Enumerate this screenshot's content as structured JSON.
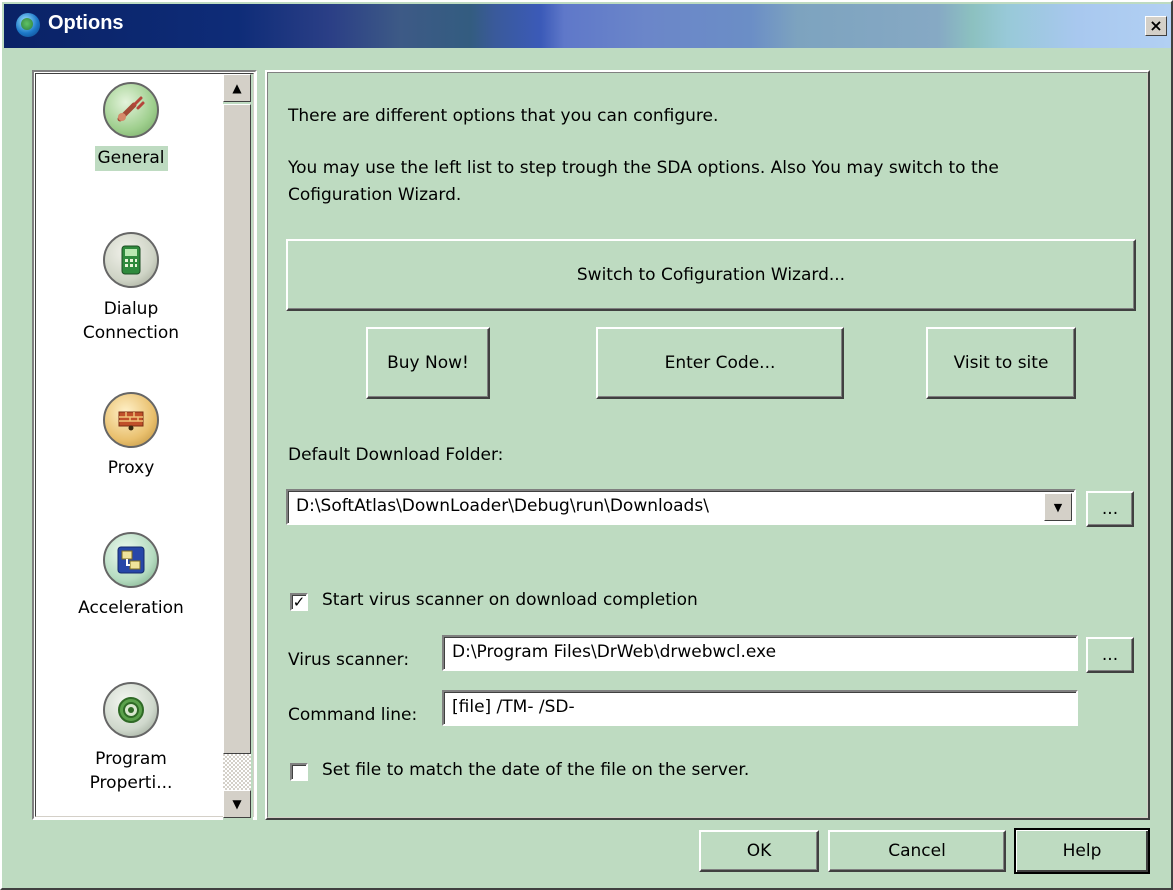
{
  "window": {
    "title": "Options",
    "close_label": "×"
  },
  "sidebar": {
    "items": [
      {
        "label": "General",
        "icon": "wrench-icon"
      },
      {
        "label": "Dialup\nConnection",
        "icon": "phone-icon"
      },
      {
        "label": "Proxy",
        "icon": "proxy-icon"
      },
      {
        "label": "Acceleration",
        "icon": "acceleration-icon"
      },
      {
        "label": "Program\nProperti...",
        "icon": "properties-icon"
      }
    ],
    "selected": "General"
  },
  "main": {
    "intro1": "There are different options that you can configure.",
    "intro2": "You may use the left list to step trough the SDA options. Also You may switch to the Cofiguration Wizard.",
    "wizard_button": "Switch to Cofiguration Wizard...",
    "buy_button": "Buy Now!",
    "code_button": "Enter Code...",
    "visit_button": "Visit to site",
    "folder_label": "Default Download Folder:",
    "folder_value": "D:\\SoftAtlas\\DownLoader\\Debug\\run\\Downloads\\",
    "browse_label": "...",
    "virus_check_label": "Start virus scanner on download completion",
    "virus_check_checked": true,
    "scanner_label": "Virus scanner:",
    "scanner_value": "D:\\Program Files\\DrWeb\\drwebwcl.exe",
    "cmdline_label": "Command line:",
    "cmdline_value": "[file] /TM- /SD-",
    "date_check_label": "Set file to match the date of the file on the server.",
    "date_check_checked": false
  },
  "footer": {
    "ok": "OK",
    "cancel": "Cancel",
    "help": "Help"
  }
}
